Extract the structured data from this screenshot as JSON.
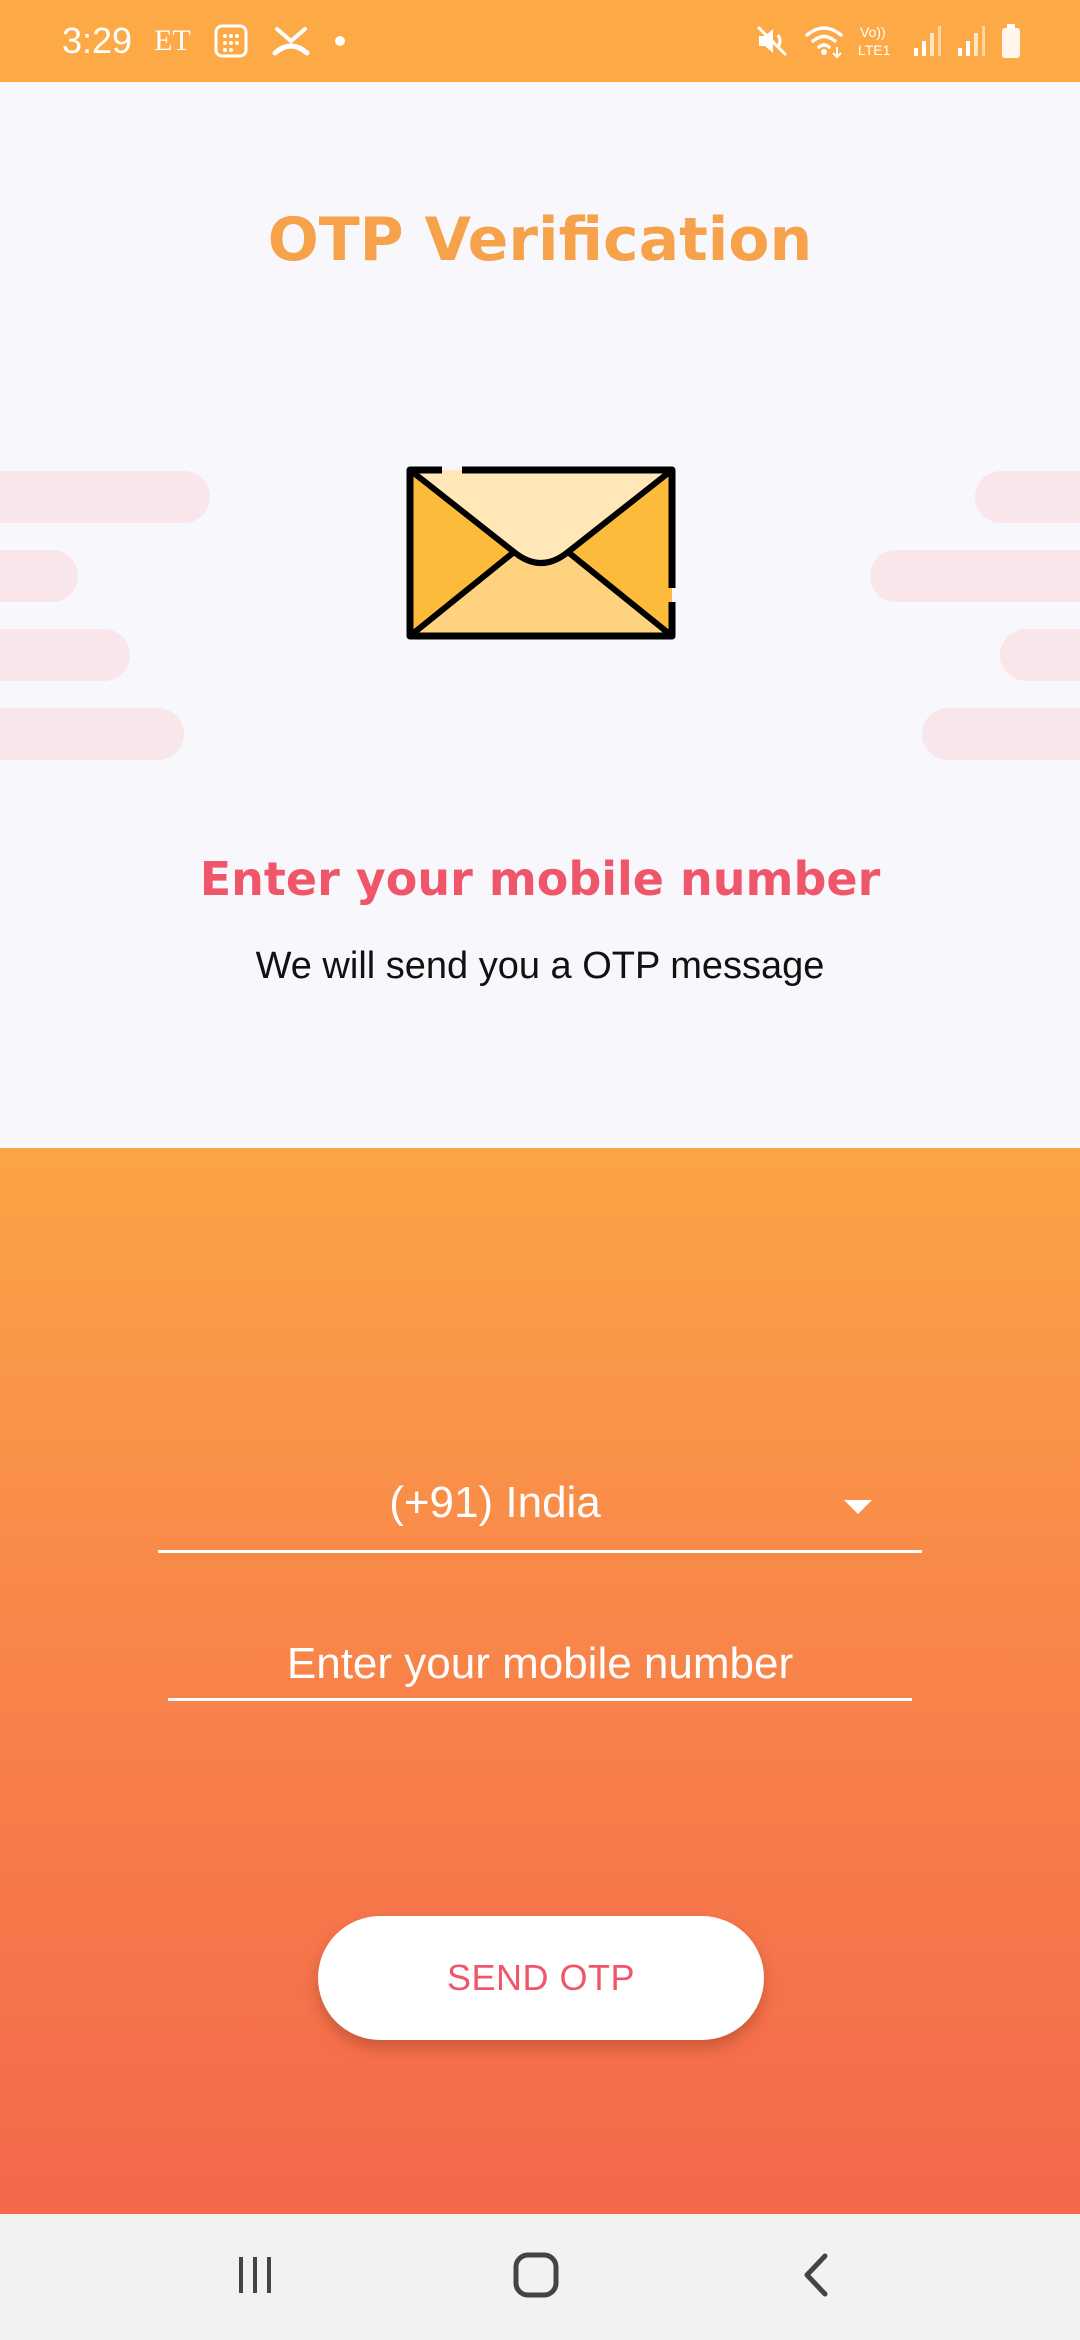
{
  "status_bar": {
    "time": "3:29",
    "carrier_badge": "ET",
    "lte_label": "Vo)) LTE1",
    "icons": [
      "calendar-icon",
      "missed-call-icon",
      "dot-icon",
      "mute-icon",
      "wifi-icon",
      "signal-icon",
      "signal-icon",
      "battery-icon"
    ]
  },
  "header": {
    "title": "OTP Verification"
  },
  "illustration": {
    "icon": "envelope-icon"
  },
  "prompt": {
    "heading": "Enter your mobile number",
    "subheading": "We will send you a OTP message"
  },
  "form": {
    "country_selected": "(+91) India",
    "phone_placeholder": "Enter your mobile number",
    "phone_value": "",
    "send_button_label": "SEND OTP"
  },
  "nav_bar": {
    "buttons": [
      "recent-apps-icon",
      "home-icon",
      "back-icon"
    ]
  },
  "colors": {
    "brand_orange": "#fda946",
    "accent_pink": "#f0566a",
    "background": "#f8f8fc",
    "gradient_top": "#fca445",
    "gradient_bottom": "#f4674a"
  }
}
